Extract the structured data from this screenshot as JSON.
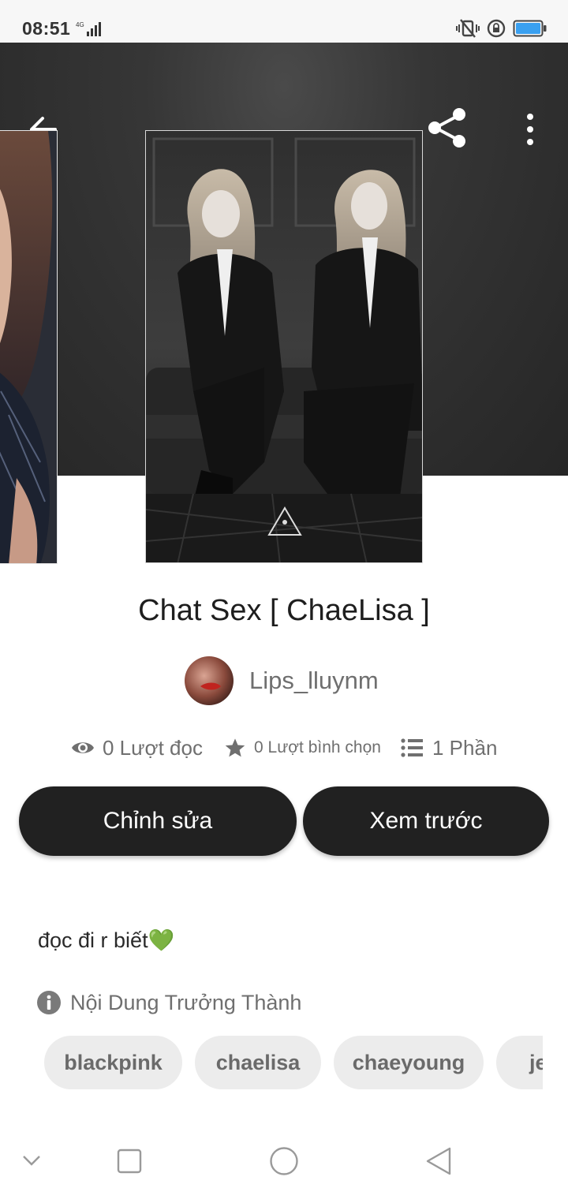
{
  "status_bar": {
    "time": "08:51",
    "network": "4G"
  },
  "header": {
    "back_icon": "arrow-left-icon",
    "share_icon": "share-icon",
    "more_icon": "more-vertical-icon"
  },
  "story": {
    "title": "Chat Sex [ ChaeLisa ]",
    "author": "Lips_lluynm",
    "stats": {
      "reads": "0 Lượt đọc",
      "votes": "0 Lượt bình chọn",
      "parts": "1 Phần"
    },
    "description": "đọc đi r biết💚",
    "mature_label": "Nội Dung Trưởng Thành",
    "tags": [
      "blackpink",
      "chaelisa",
      "chaeyoung",
      "je"
    ]
  },
  "actions": {
    "edit_label": "Chỉnh sửa",
    "preview_label": "Xem trước"
  },
  "colors": {
    "banner": "#2e2e2e",
    "button": "#212121",
    "tag_bg": "#ececec",
    "battery": "#3aa0f0"
  }
}
